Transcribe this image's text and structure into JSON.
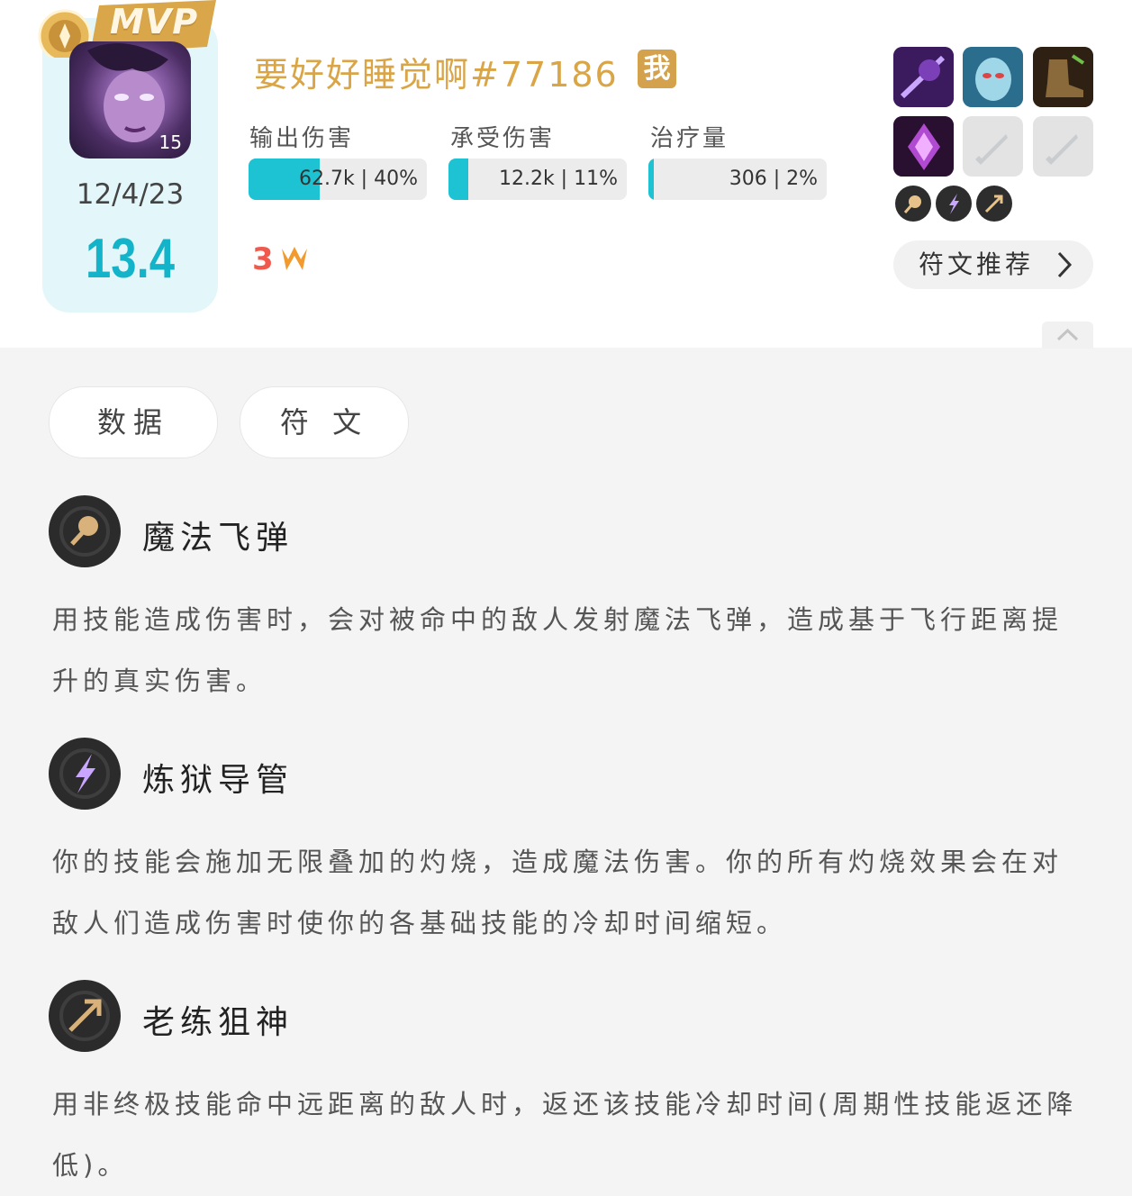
{
  "header": {
    "mvp_label": "MVP",
    "champion_level": "15",
    "date": "12/4/23",
    "score": "13.4",
    "player_name": "要好好睡觉啊#77186",
    "me_badge": "我"
  },
  "stats": [
    {
      "label": "输出伤害",
      "value_text": "62.7k | 40%",
      "fill": 0.4
    },
    {
      "label": "承受伤害",
      "value_text": "12.2k | 11%",
      "fill": 0.11
    },
    {
      "label": "治疗量",
      "value_text": "306 | 2%",
      "fill": 0.02
    }
  ],
  "streak": {
    "count": "3",
    "icon": "flame-w-icon"
  },
  "items": [
    {
      "name": "dark-staff-item-icon",
      "color": "#5b2d8a"
    },
    {
      "name": "frost-mask-item-icon",
      "color": "#3f8fb5"
    },
    {
      "name": "boots-item-icon",
      "color": "#3a2a18"
    },
    {
      "name": "void-crystal-item-icon",
      "color": "#6a2a7a"
    },
    {
      "name": "empty-item-slot-icon",
      "color": "#e3e3e3"
    },
    {
      "name": "empty-item-slot-icon",
      "color": "#e3e3e3"
    }
  ],
  "small_runes": [
    "arcane-comet-icon",
    "torch-icon",
    "hunter-icon"
  ],
  "rune_recommend_label": "符文推荐",
  "tabs": {
    "data_label": "数据",
    "runes_label": "符 文"
  },
  "runes": [
    {
      "title": "魔法飞弹",
      "icon": "arcane-missile-icon",
      "description": "用技能造成伤害时，会对被命中的敌人发射魔法飞弹，造成基于飞行距离提升的真实伤害。"
    },
    {
      "title": "炼狱导管",
      "icon": "inferno-conduit-icon",
      "description": "你的技能会施加无限叠加的灼烧，造成魔法伤害。你的所有灼烧效果会在对敌人们造成伤害时使你的各基础技能的冷却时间缩短。"
    },
    {
      "title": "老练狙神",
      "icon": "veteran-sniper-icon",
      "description": "用非终极技能命中远距离的敌人时，返还该技能冷却时间(周期性技能返还降低)。"
    }
  ]
}
